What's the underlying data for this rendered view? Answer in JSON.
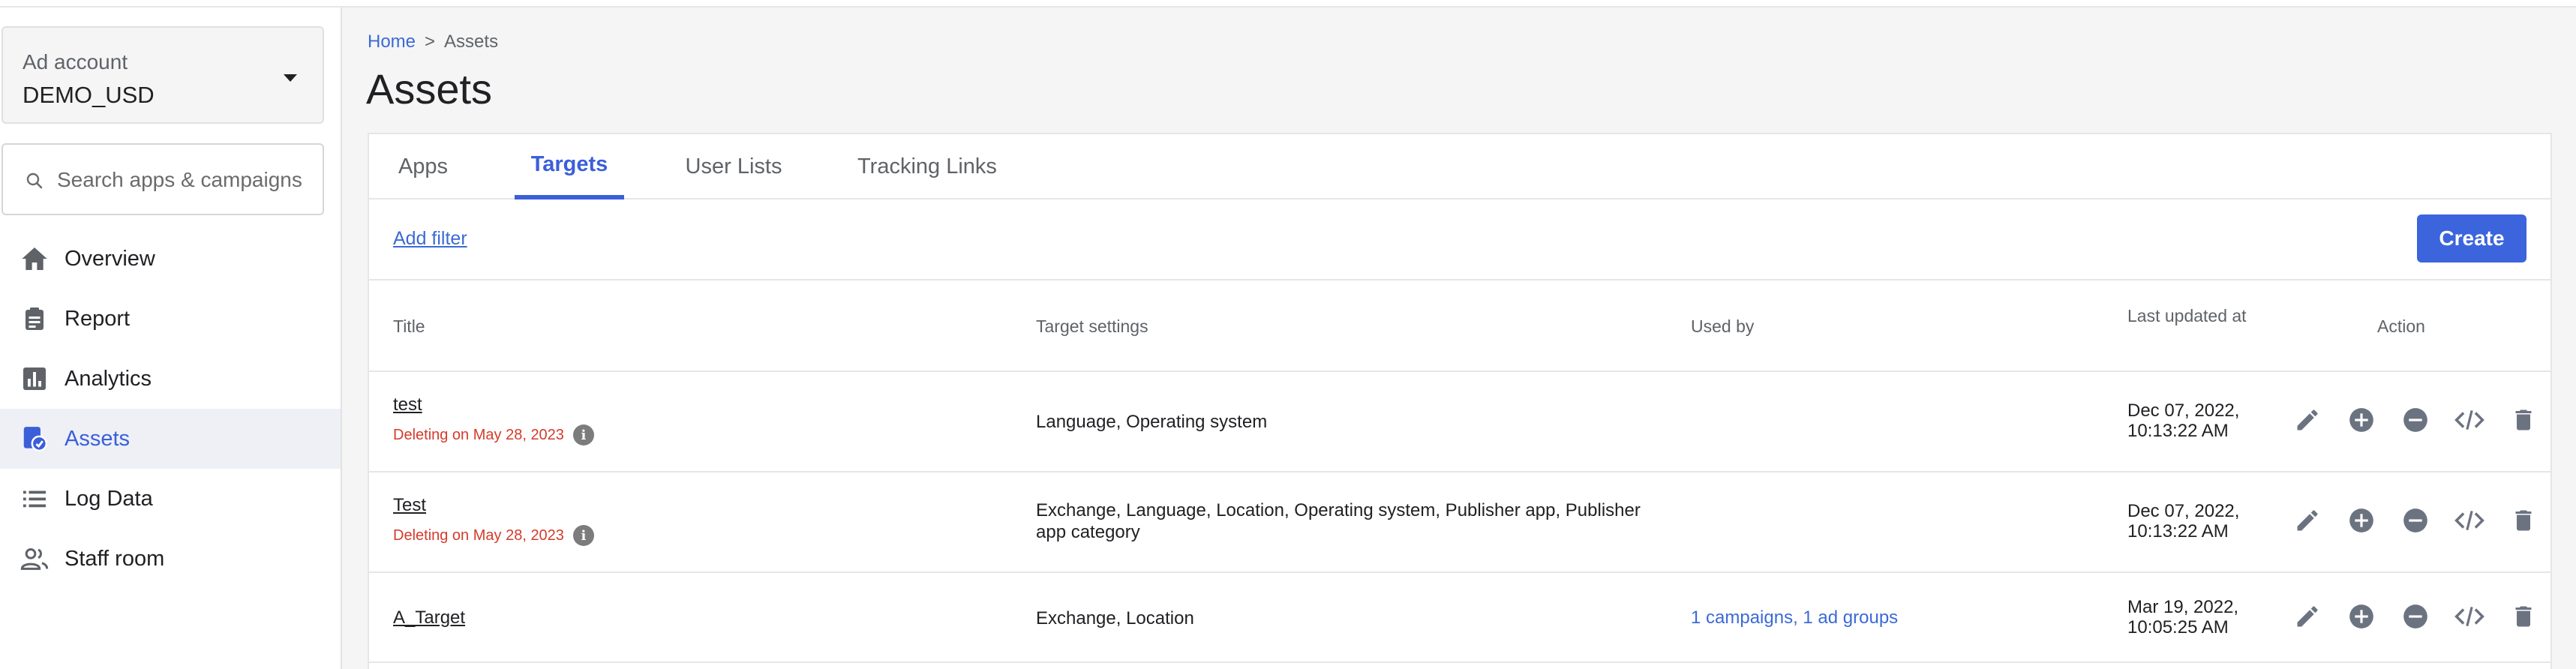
{
  "account": {
    "label": "Ad account",
    "value": "DEMO_USD"
  },
  "search": {
    "placeholder": "Search apps & campaigns"
  },
  "nav": [
    {
      "label": "Overview",
      "icon": "home-icon"
    },
    {
      "label": "Report",
      "icon": "clipboard-icon"
    },
    {
      "label": "Analytics",
      "icon": "bar-chart-icon"
    },
    {
      "label": "Assets",
      "icon": "assets-icon",
      "active": true
    },
    {
      "label": "Log Data",
      "icon": "list-icon"
    },
    {
      "label": "Staff room",
      "icon": "people-icon"
    }
  ],
  "breadcrumb": {
    "home": "Home",
    "separator": ">",
    "current": "Assets"
  },
  "page": {
    "title": "Assets"
  },
  "tabs": [
    {
      "label": "Apps"
    },
    {
      "label": "Targets",
      "active": true
    },
    {
      "label": "User Lists"
    },
    {
      "label": "Tracking Links"
    }
  ],
  "toolbar": {
    "add_filter": "Add filter",
    "create": "Create"
  },
  "table": {
    "headers": {
      "title": "Title",
      "settings": "Target settings",
      "used_by": "Used by",
      "updated": "Last updated at",
      "action": "Action"
    },
    "rows": [
      {
        "title": "test",
        "deleting": "Deleting on May 28, 2023",
        "settings": "Language, Operating system",
        "used_by": "",
        "updated_line1": "Dec 07, 2022,",
        "updated_line2": "10:13:22 AM"
      },
      {
        "title": "Test",
        "deleting": "Deleting on May 28, 2023",
        "settings": "Exchange, Language, Location, Operating system, Publisher app, Publisher app category",
        "used_by": "",
        "updated_line1": "Dec 07, 2022,",
        "updated_line2": "10:13:22 AM"
      },
      {
        "title": "A_Target",
        "deleting": "",
        "settings": "Exchange, Location",
        "used_by": "1 campaigns, 1 ad groups",
        "updated_line1": "Mar 19, 2022,",
        "updated_line2": "10:05:25 AM"
      }
    ]
  },
  "colors": {
    "accent": "#3c64dc",
    "danger": "#d43b2b",
    "link": "#3b6ad6",
    "icon": "#6b7280"
  }
}
